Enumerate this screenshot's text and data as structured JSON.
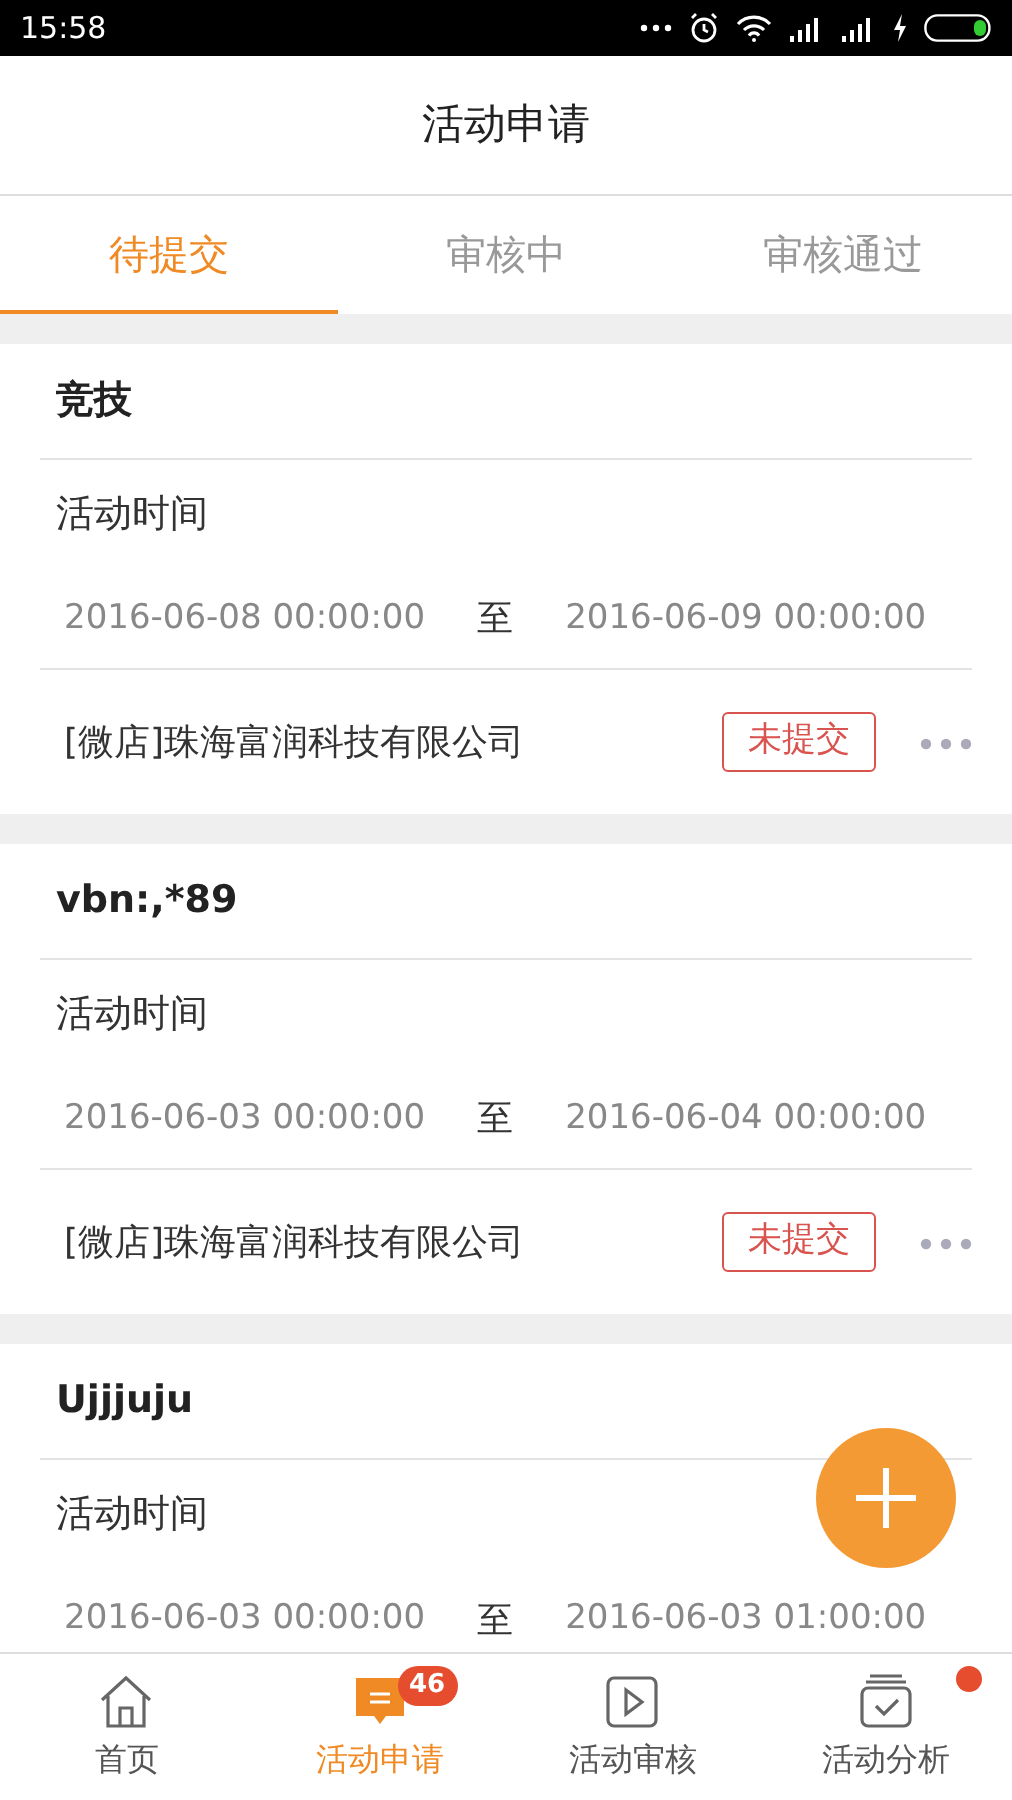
{
  "status_bar": {
    "time": "15:58"
  },
  "header": {
    "title": "活动申请"
  },
  "tabs": [
    {
      "label": "待提交",
      "selected": true
    },
    {
      "label": "审核中",
      "selected": false
    },
    {
      "label": "审核通过",
      "selected": false
    }
  ],
  "activities": [
    {
      "title": "竞技",
      "time_label": "活动时间",
      "start": "2016-06-08 00:00:00",
      "separator": "至",
      "end": "2016-06-09 00:00:00",
      "shop": "[微店]珠海富润科技有限公司",
      "status": "未提交"
    },
    {
      "title": "vbn:,*89",
      "time_label": "活动时间",
      "start": "2016-06-03 00:00:00",
      "separator": "至",
      "end": "2016-06-04 00:00:00",
      "shop": "[微店]珠海富润科技有限公司",
      "status": "未提交"
    },
    {
      "title": "Ujjjuju",
      "time_label": "活动时间",
      "start": "2016-06-03 00:00:00",
      "separator": "至",
      "end": "2016-06-03 01:00:00"
    }
  ],
  "bottom_nav": [
    {
      "label": "首页",
      "selected": false
    },
    {
      "label": "活动申请",
      "selected": true,
      "badge": "46"
    },
    {
      "label": "活动审核",
      "selected": false
    },
    {
      "label": "活动分析",
      "selected": false,
      "dot": true
    }
  ]
}
